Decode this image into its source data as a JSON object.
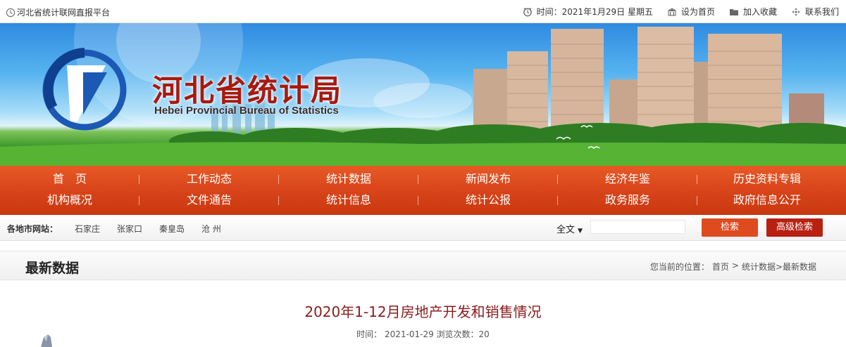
{
  "topbar": {
    "platform": "河北省统计联网直报平台",
    "time_label": "时间：",
    "date": "2021年1月29日",
    "weekday": "星期五",
    "set_home": "设为首页",
    "add_fav": "加入收藏",
    "contact": "联系我们"
  },
  "banner": {
    "title": "河北省统计局",
    "subtitle": "Hebei Provincial Bureau of Statistics"
  },
  "nav": {
    "row1": [
      "首　页",
      "工作动态",
      "统计数据",
      "新闻发布",
      "经济年鉴",
      "历史资料专辑"
    ],
    "row2": [
      "机构概况",
      "文件通告",
      "统计信息",
      "统计公报",
      "政务服务",
      "政府信息公开"
    ]
  },
  "citybar": {
    "label": "各地市网站：",
    "cities": [
      "石家庄",
      "张家口",
      "秦皇岛",
      "沧 州"
    ],
    "search_type": "全文",
    "search_button": "检索",
    "advanced_button": "高级检索"
  },
  "section": {
    "title": "最新数据",
    "crumb_label": "您当前的位置：",
    "crumb_home": "首页",
    "crumb_sep": ">",
    "crumb_path": "统计数据>最新数据"
  },
  "article": {
    "title": "2020年1-12月房地产开发和销售情况",
    "meta": "时间：  2021-01-29 浏览次数：20"
  },
  "colors": {
    "nav_bg": "#d9441a",
    "title_red": "#a8190f",
    "search_btn": "#dd4b1f",
    "adv_btn": "#b82112"
  }
}
